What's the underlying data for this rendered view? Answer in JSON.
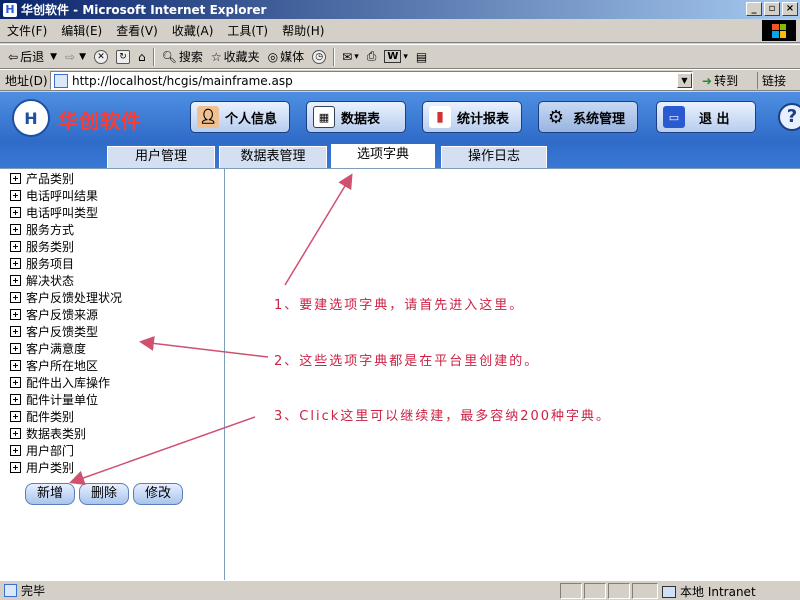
{
  "window": {
    "title": "华创软件 - Microsoft Internet Explorer"
  },
  "menubar": {
    "items": [
      "文件(F)",
      "编辑(E)",
      "查看(V)",
      "收藏(A)",
      "工具(T)",
      "帮助(H)"
    ]
  },
  "toolbar": {
    "back": "后退",
    "search": "搜索",
    "favorites": "收藏夹",
    "media": "媒体"
  },
  "addressbar": {
    "label": "地址(D)",
    "url": "http://localhost/hcgis/mainframe.asp",
    "go": "转到",
    "links": "链接"
  },
  "app": {
    "logo_text": "华创软件",
    "nav": [
      {
        "label": "个人信息",
        "icon": "person-icon"
      },
      {
        "label": "数据表",
        "icon": "table-icon"
      },
      {
        "label": "统计报表",
        "icon": "chart-icon"
      },
      {
        "label": "系统管理",
        "icon": "gear-icon"
      },
      {
        "label": "退 出",
        "icon": "exit-icon"
      }
    ],
    "help": "?"
  },
  "tabs": [
    {
      "label": "用户管理"
    },
    {
      "label": "数据表管理"
    },
    {
      "label": "选项字典",
      "active": true
    },
    {
      "label": "操作日志"
    }
  ],
  "tree": [
    "产品类别",
    "电话呼叫结果",
    "电话呼叫类型",
    "服务方式",
    "服务类别",
    "服务项目",
    "解决状态",
    "客户反馈处理状况",
    "客户反馈来源",
    "客户反馈类型",
    "客户满意度",
    "客户所在地区",
    "配件出入库操作",
    "配件计量单位",
    "配件类别",
    "数据表类别",
    "用户部门",
    "用户类别"
  ],
  "actions": {
    "add": "新增",
    "delete": "删除",
    "edit": "修改"
  },
  "notes": [
    "1、要建选项字典，请首先进入这里。",
    "2、这些选项字典都是在平台里创建的。",
    "3、Click这里可以继续建，最多容纳200种字典。"
  ],
  "status": {
    "left": "完毕",
    "zone": "本地 Intranet"
  },
  "colors": {
    "note": "#cc2244",
    "header_bg": "#3f7fd8",
    "logo_red": "#ff3b2f"
  }
}
